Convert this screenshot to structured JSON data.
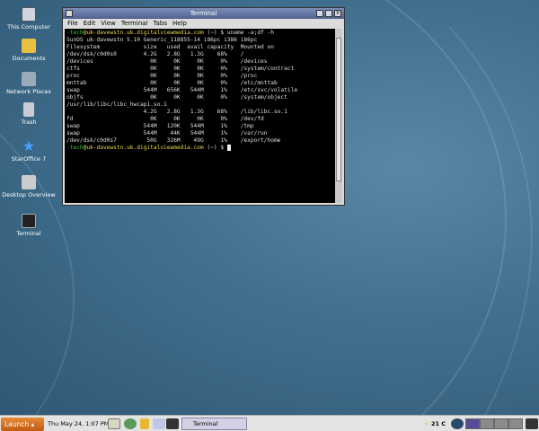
{
  "desktop_icons": [
    {
      "label": "This Computer",
      "icon": "computer-icon"
    },
    {
      "label": "Documents",
      "icon": "folder-icon"
    },
    {
      "label": "Network Places",
      "icon": "network-icon"
    },
    {
      "label": "Trash",
      "icon": "trash-icon"
    },
    {
      "label": "StarOffice 7",
      "icon": "staroffice-icon"
    },
    {
      "label": "Desktop Overview",
      "icon": "desktop-overview-icon"
    },
    {
      "label": "Terminal",
      "icon": "terminal-icon"
    }
  ],
  "window": {
    "title": "Terminal",
    "menu": [
      "File",
      "Edit",
      "View",
      "Terminal",
      "Tabs",
      "Help"
    ],
    "prompt_user": "-tech",
    "prompt_host": "@uk-davewstn.uk.digitalviewmedia.com",
    "prompt_tail": " (~) $ ",
    "command": "uname -a;df -h",
    "output": [
      "SunOS uk-davewstn 5.10 Generic_118855-14 i86pc i386 i86pc",
      "Filesystem             size   used  avail capacity  Mounted on",
      "/dev/dsk/c0d0s0        4.2G   2.8G   1.3G    68%    /",
      "/devices                 0K     0K     0K     0%    /devices",
      "ctfs                     0K     0K     0K     0%    /system/contract",
      "proc                     0K     0K     0K     0%    /proc",
      "mnttab                   0K     0K     0K     0%    /etc/mnttab",
      "swap                   544M   656K   544M     1%    /etc/svc/volatile",
      "objfs                    0K     0K     0K     0%    /system/object",
      "/usr/lib/libc/libc_hwcap1.so.1",
      "                       4.2G   2.8G   1.3G    68%    /lib/libc.so.1",
      "fd                       0K     0K     0K     0%    /dev/fd",
      "swap                   544M   120K   544M     1%    /tmp",
      "swap                   544M    44K   544M     1%    /var/run",
      "/dev/dsk/c0d0s7         50G   326M    49G     1%    /export/home"
    ]
  },
  "panel": {
    "launch": "Launch",
    "clock": "Thu May 24,  1:07 PM",
    "task": "Terminal",
    "weather": "21 C"
  }
}
